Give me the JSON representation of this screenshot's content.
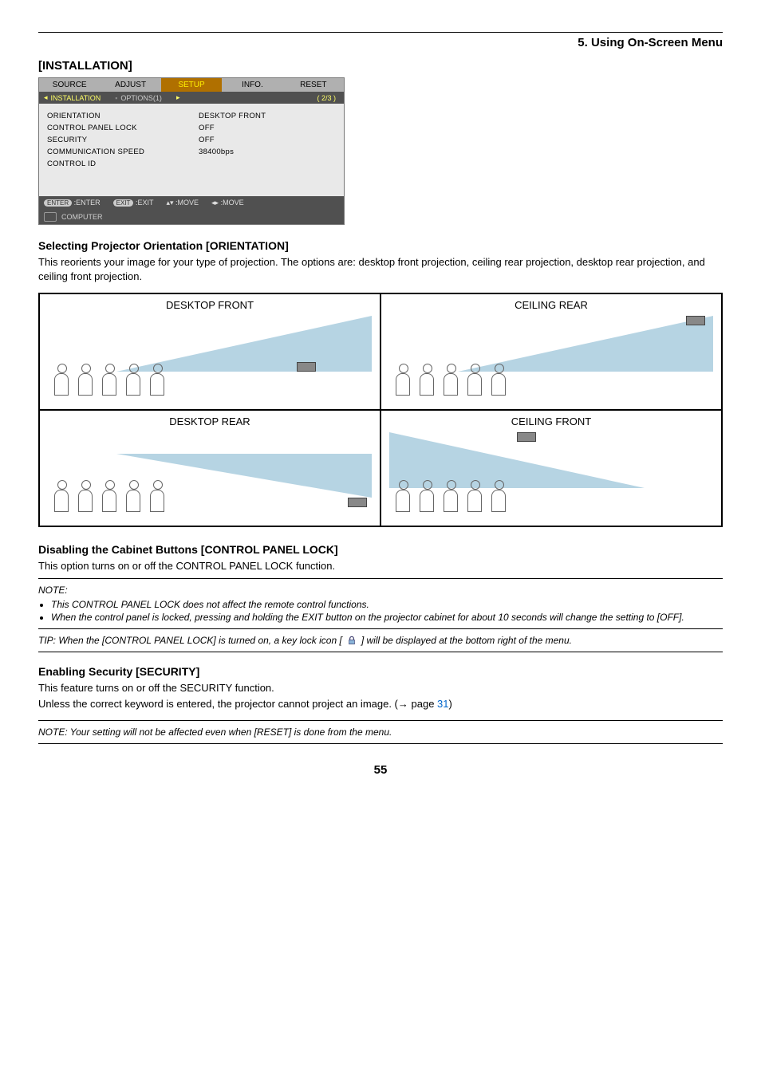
{
  "header": {
    "chapter": "5. Using On-Screen Menu"
  },
  "section_title": "[INSTALLATION]",
  "menu": {
    "tabs": [
      "SOURCE",
      "ADJUST",
      "SETUP",
      "INFO.",
      "RESET"
    ],
    "active_tab_index": 2,
    "subtabs": {
      "selected": "INSTALLATION",
      "other": "OPTIONS(1)",
      "pager": "2/3"
    },
    "items": [
      {
        "label": "ORIENTATION",
        "value": "DESKTOP FRONT"
      },
      {
        "label": "CONTROL PANEL LOCK",
        "value": "OFF"
      },
      {
        "label": "SECURITY",
        "value": "OFF"
      },
      {
        "label": "COMMUNICATION SPEED",
        "value": "38400bps"
      },
      {
        "label": "CONTROL ID",
        "value": ""
      }
    ],
    "footer": {
      "enter_pill": "ENTER",
      "enter_lab": ":ENTER",
      "exit_pill": "EXIT",
      "exit_lab": ":EXIT",
      "move_v": ":MOVE",
      "move_h": ":MOVE"
    },
    "source_row": "COMPUTER"
  },
  "orientation": {
    "heading": "Selecting Projector Orientation [ORIENTATION]",
    "body": "This reorients your image for your type of projection. The options are: desktop front projection, ceiling rear projection, desktop rear projection, and ceiling front projection.",
    "cells": {
      "df": "DESKTOP FRONT",
      "cr": "CEILING REAR",
      "dr": "DESKTOP REAR",
      "cf": "CEILING FRONT"
    }
  },
  "cpl": {
    "heading": "Disabling the Cabinet Buttons [CONTROL PANEL LOCK]",
    "body": "This option turns on or off the CONTROL PANEL LOCK function.",
    "note_label": "NOTE:",
    "note1": "This CONTROL PANEL LOCK does not affect the remote control functions.",
    "note2": "When the control panel is locked, pressing and holding the EXIT button on the projector cabinet for about 10 seconds will change the setting to [OFF].",
    "tip_pre": "TIP: When the [CONTROL PANEL LOCK] is turned on, a key lock icon [",
    "tip_post": "] will be displayed at the bottom right of the menu."
  },
  "security": {
    "heading": "Enabling Security [SECURITY]",
    "body1": "This feature turns on or off the SECURITY function.",
    "body2_pre": "Unless the correct keyword is entered, the projector cannot project an image. (→ page ",
    "body2_link": "31",
    "body2_post": ")",
    "note": "NOTE: Your setting will not be affected even when [RESET] is done from the menu."
  },
  "page_number": "55"
}
